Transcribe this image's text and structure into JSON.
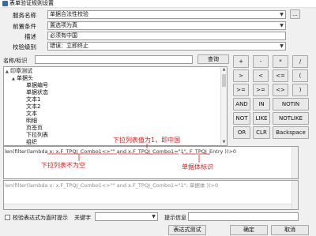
{
  "window": {
    "title": "表单验证规则设置"
  },
  "form": {
    "rule_name": {
      "label": "服务名称",
      "value": "单据合法性校验"
    },
    "precondition": {
      "label": "前置条件",
      "value": "置选项为真"
    },
    "description": {
      "label": "描述",
      "value": "必须有中国"
    },
    "level": {
      "label": "校验级别",
      "value": "错误：立即终止"
    },
    "more_label": "..."
  },
  "search": {
    "label": "名称/标识",
    "value": "",
    "query_button": "查询"
  },
  "tree": {
    "nodes": [
      {
        "label": "印章测试",
        "level": 0,
        "toggle": "▲"
      },
      {
        "label": "单据头",
        "level": 1,
        "toggle": "▲"
      },
      {
        "label": "单据编号",
        "level": 2,
        "toggle": ""
      },
      {
        "label": "单据状态",
        "level": 2,
        "toggle": ""
      },
      {
        "label": "文本1",
        "level": 2,
        "toggle": ""
      },
      {
        "label": "文本2",
        "level": 2,
        "toggle": ""
      },
      {
        "label": "文本",
        "level": 2,
        "toggle": ""
      },
      {
        "label": "明细",
        "level": 2,
        "toggle": ""
      },
      {
        "label": "页签页",
        "level": 2,
        "toggle": ""
      },
      {
        "label": "下拉列表",
        "level": 2,
        "toggle": ""
      },
      {
        "label": "组织",
        "level": 2,
        "toggle": ""
      }
    ]
  },
  "operators": {
    "row1": [
      "+",
      "-",
      "*",
      "/"
    ],
    "row2": [
      ">",
      "<",
      "<=",
      "("
    ],
    "row3": [
      ">=",
      ">=",
      "<>",
      ")"
    ],
    "row4": [
      "AND",
      "IN",
      "NOTIN"
    ],
    "row5": [
      "NOT",
      "LIKE",
      "NOTLIKE"
    ],
    "row6": [
      "OR",
      "CLR",
      "Backspace"
    ]
  },
  "expression": {
    "main": "len(filter(lambda x: x.F_TPQJ_Combo1<>\"\" and x.F_TPQJ_Combo1=\"1\", F_TPQJ_Entry ))>0",
    "preview": "len(filter(lambda x: x.F_TPQJ_Combo1<>\"\" and x.F_TPQJ_Combo1=\"1\", 单据体 ))>0"
  },
  "annotations": {
    "dropdown_eq": "下拉列表值为1，即中国",
    "dropdown_nonempty": "下拉列表不为空",
    "entry_id": "单据体标识"
  },
  "footer": {
    "realtime_label": "校验表达式为直时提示",
    "keyword_label": "关键字",
    "keyword_value": "",
    "hint_label": "提示信息",
    "hint_value": "",
    "test_button": "表达式测试",
    "ok_button": "确定",
    "cancel_button": "取消"
  },
  "colors": {
    "annotation": "#e01818",
    "accent": "#2b6cc4"
  }
}
